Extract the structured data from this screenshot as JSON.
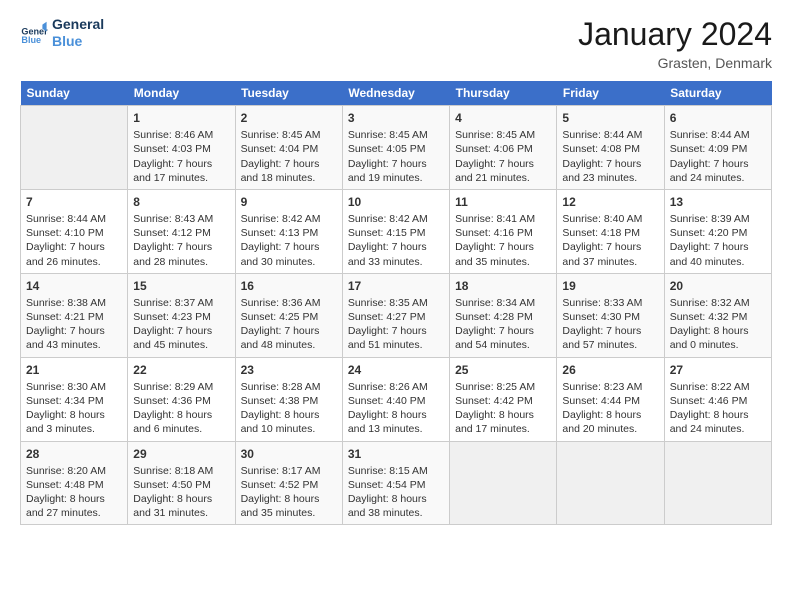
{
  "logo": {
    "line1": "General",
    "line2": "Blue"
  },
  "title": "January 2024",
  "location": "Grasten, Denmark",
  "days_of_week": [
    "Sunday",
    "Monday",
    "Tuesday",
    "Wednesday",
    "Thursday",
    "Friday",
    "Saturday"
  ],
  "weeks": [
    [
      {
        "day": "",
        "sunrise": "",
        "sunset": "",
        "daylight": ""
      },
      {
        "day": "1",
        "sunrise": "Sunrise: 8:46 AM",
        "sunset": "Sunset: 4:03 PM",
        "daylight": "Daylight: 7 hours and 17 minutes."
      },
      {
        "day": "2",
        "sunrise": "Sunrise: 8:45 AM",
        "sunset": "Sunset: 4:04 PM",
        "daylight": "Daylight: 7 hours and 18 minutes."
      },
      {
        "day": "3",
        "sunrise": "Sunrise: 8:45 AM",
        "sunset": "Sunset: 4:05 PM",
        "daylight": "Daylight: 7 hours and 19 minutes."
      },
      {
        "day": "4",
        "sunrise": "Sunrise: 8:45 AM",
        "sunset": "Sunset: 4:06 PM",
        "daylight": "Daylight: 7 hours and 21 minutes."
      },
      {
        "day": "5",
        "sunrise": "Sunrise: 8:44 AM",
        "sunset": "Sunset: 4:08 PM",
        "daylight": "Daylight: 7 hours and 23 minutes."
      },
      {
        "day": "6",
        "sunrise": "Sunrise: 8:44 AM",
        "sunset": "Sunset: 4:09 PM",
        "daylight": "Daylight: 7 hours and 24 minutes."
      }
    ],
    [
      {
        "day": "7",
        "sunrise": "Sunrise: 8:44 AM",
        "sunset": "Sunset: 4:10 PM",
        "daylight": "Daylight: 7 hours and 26 minutes."
      },
      {
        "day": "8",
        "sunrise": "Sunrise: 8:43 AM",
        "sunset": "Sunset: 4:12 PM",
        "daylight": "Daylight: 7 hours and 28 minutes."
      },
      {
        "day": "9",
        "sunrise": "Sunrise: 8:42 AM",
        "sunset": "Sunset: 4:13 PM",
        "daylight": "Daylight: 7 hours and 30 minutes."
      },
      {
        "day": "10",
        "sunrise": "Sunrise: 8:42 AM",
        "sunset": "Sunset: 4:15 PM",
        "daylight": "Daylight: 7 hours and 33 minutes."
      },
      {
        "day": "11",
        "sunrise": "Sunrise: 8:41 AM",
        "sunset": "Sunset: 4:16 PM",
        "daylight": "Daylight: 7 hours and 35 minutes."
      },
      {
        "day": "12",
        "sunrise": "Sunrise: 8:40 AM",
        "sunset": "Sunset: 4:18 PM",
        "daylight": "Daylight: 7 hours and 37 minutes."
      },
      {
        "day": "13",
        "sunrise": "Sunrise: 8:39 AM",
        "sunset": "Sunset: 4:20 PM",
        "daylight": "Daylight: 7 hours and 40 minutes."
      }
    ],
    [
      {
        "day": "14",
        "sunrise": "Sunrise: 8:38 AM",
        "sunset": "Sunset: 4:21 PM",
        "daylight": "Daylight: 7 hours and 43 minutes."
      },
      {
        "day": "15",
        "sunrise": "Sunrise: 8:37 AM",
        "sunset": "Sunset: 4:23 PM",
        "daylight": "Daylight: 7 hours and 45 minutes."
      },
      {
        "day": "16",
        "sunrise": "Sunrise: 8:36 AM",
        "sunset": "Sunset: 4:25 PM",
        "daylight": "Daylight: 7 hours and 48 minutes."
      },
      {
        "day": "17",
        "sunrise": "Sunrise: 8:35 AM",
        "sunset": "Sunset: 4:27 PM",
        "daylight": "Daylight: 7 hours and 51 minutes."
      },
      {
        "day": "18",
        "sunrise": "Sunrise: 8:34 AM",
        "sunset": "Sunset: 4:28 PM",
        "daylight": "Daylight: 7 hours and 54 minutes."
      },
      {
        "day": "19",
        "sunrise": "Sunrise: 8:33 AM",
        "sunset": "Sunset: 4:30 PM",
        "daylight": "Daylight: 7 hours and 57 minutes."
      },
      {
        "day": "20",
        "sunrise": "Sunrise: 8:32 AM",
        "sunset": "Sunset: 4:32 PM",
        "daylight": "Daylight: 8 hours and 0 minutes."
      }
    ],
    [
      {
        "day": "21",
        "sunrise": "Sunrise: 8:30 AM",
        "sunset": "Sunset: 4:34 PM",
        "daylight": "Daylight: 8 hours and 3 minutes."
      },
      {
        "day": "22",
        "sunrise": "Sunrise: 8:29 AM",
        "sunset": "Sunset: 4:36 PM",
        "daylight": "Daylight: 8 hours and 6 minutes."
      },
      {
        "day": "23",
        "sunrise": "Sunrise: 8:28 AM",
        "sunset": "Sunset: 4:38 PM",
        "daylight": "Daylight: 8 hours and 10 minutes."
      },
      {
        "day": "24",
        "sunrise": "Sunrise: 8:26 AM",
        "sunset": "Sunset: 4:40 PM",
        "daylight": "Daylight: 8 hours and 13 minutes."
      },
      {
        "day": "25",
        "sunrise": "Sunrise: 8:25 AM",
        "sunset": "Sunset: 4:42 PM",
        "daylight": "Daylight: 8 hours and 17 minutes."
      },
      {
        "day": "26",
        "sunrise": "Sunrise: 8:23 AM",
        "sunset": "Sunset: 4:44 PM",
        "daylight": "Daylight: 8 hours and 20 minutes."
      },
      {
        "day": "27",
        "sunrise": "Sunrise: 8:22 AM",
        "sunset": "Sunset: 4:46 PM",
        "daylight": "Daylight: 8 hours and 24 minutes."
      }
    ],
    [
      {
        "day": "28",
        "sunrise": "Sunrise: 8:20 AM",
        "sunset": "Sunset: 4:48 PM",
        "daylight": "Daylight: 8 hours and 27 minutes."
      },
      {
        "day": "29",
        "sunrise": "Sunrise: 8:18 AM",
        "sunset": "Sunset: 4:50 PM",
        "daylight": "Daylight: 8 hours and 31 minutes."
      },
      {
        "day": "30",
        "sunrise": "Sunrise: 8:17 AM",
        "sunset": "Sunset: 4:52 PM",
        "daylight": "Daylight: 8 hours and 35 minutes."
      },
      {
        "day": "31",
        "sunrise": "Sunrise: 8:15 AM",
        "sunset": "Sunset: 4:54 PM",
        "daylight": "Daylight: 8 hours and 38 minutes."
      },
      {
        "day": "",
        "sunrise": "",
        "sunset": "",
        "daylight": ""
      },
      {
        "day": "",
        "sunrise": "",
        "sunset": "",
        "daylight": ""
      },
      {
        "day": "",
        "sunrise": "",
        "sunset": "",
        "daylight": ""
      }
    ]
  ]
}
